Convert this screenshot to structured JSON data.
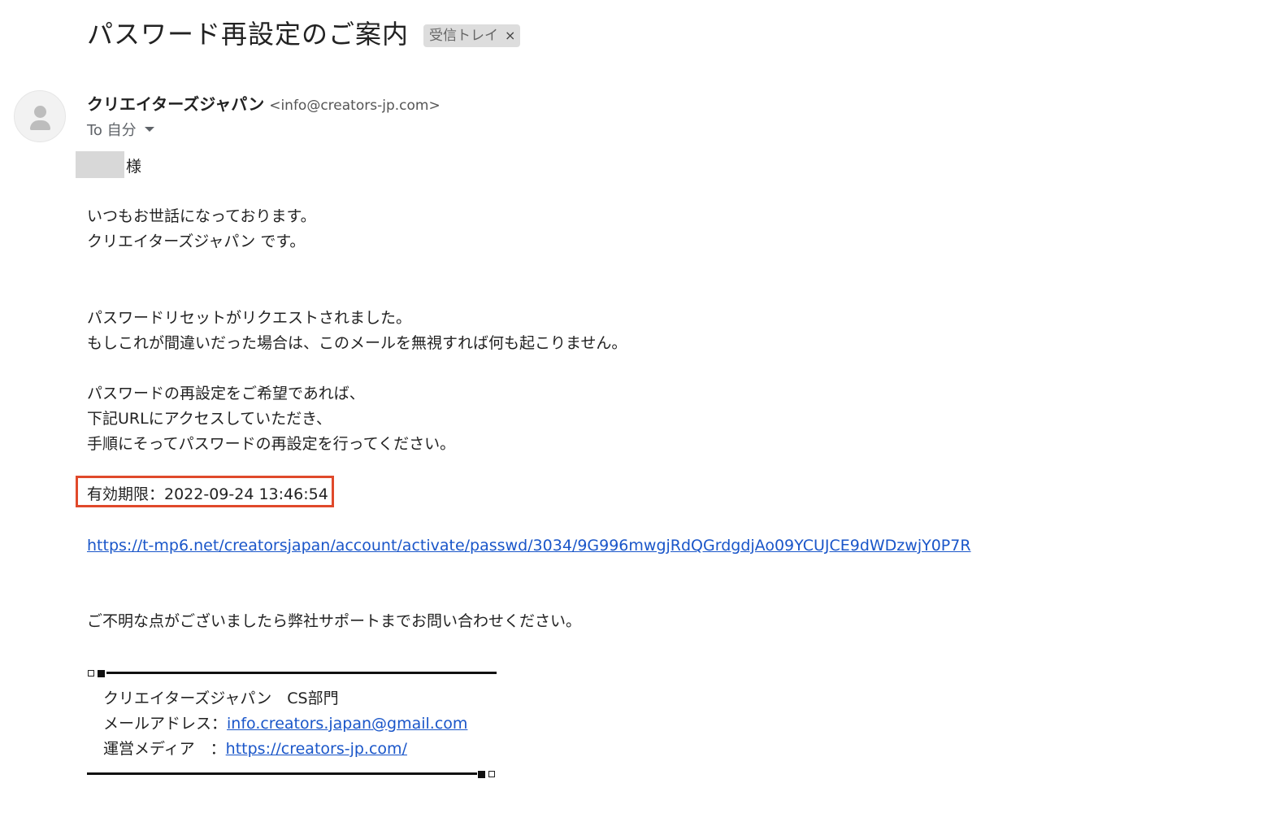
{
  "email": {
    "subject": "パスワード再設定のご案内",
    "label_chip": "受信トレイ",
    "label_chip_close": "×",
    "sender_name": "クリエイターズジャパン",
    "sender_email": "<info@creators-jp.com>",
    "to_text": "To 自分",
    "avatar_icon": "person-icon"
  },
  "body": {
    "salutation": "様",
    "greeting_1": "いつもお世話になっております。",
    "greeting_2": "クリエイターズジャパン です。",
    "reset_1": "パスワードリセットがリクエストされました。",
    "reset_2": "もしこれが間違いだった場合は、このメールを無視すれば何も起こりません。",
    "instr_1": "パスワードの再設定をご希望であれば、",
    "instr_2": "下記URLにアクセスしていただき、",
    "instr_3": "手順にそってパスワードの再設定を行ってください。",
    "expiry": "有効期限：2022-09-24 13:46:54",
    "reset_url": "https://t-mp6.net/creatorsjapan/account/activate/passwd/3034/9G996mwgjRdQGrdgdjAo09YCUJCE9dWDzwjY0P7R",
    "support": "ご不明な点がございましたら弊社サポートまでお問い合わせください。"
  },
  "signature": {
    "company": "クリエイターズジャパン　CS部門",
    "email_label": "メールアドレス：",
    "email_value": "info.creators.japan@gmail.com",
    "media_label": "運営メディア　：",
    "media_value": "https://creators-jp.com/"
  },
  "colors": {
    "highlight_box": "#e0492b",
    "link": "#1a56c9",
    "chip_bg": "#dddddd"
  }
}
